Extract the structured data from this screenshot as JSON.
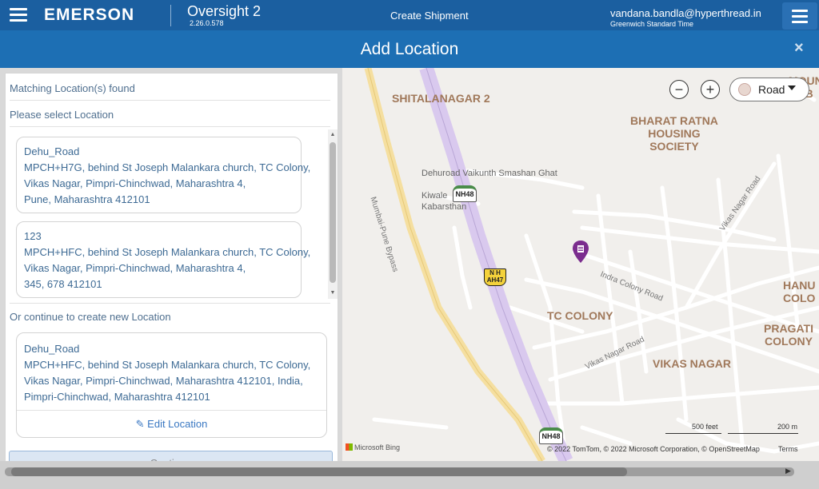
{
  "topbar": {
    "brand": "EMERSON",
    "app_name": "Oversight 2",
    "app_version": "2.26.0.578",
    "page_name": "Create Shipment",
    "user_email": "vandana.bandla@hyperthread.in",
    "user_timezone": "Greenwich Standard Time"
  },
  "dialog": {
    "title": "Add Location",
    "close_glyph": "×"
  },
  "left_panel": {
    "matching_heading": "Matching Location(s) found",
    "select_heading": "Please select Location",
    "locations": [
      {
        "lines": [
          "Dehu_Road",
          "MPCH+H7G, behind St Joseph Malankara church, TC Colony,",
          "Vikas Nagar, Pimpri-Chinchwad, Maharashtra 4,",
          "Pune, Maharashtra 412101"
        ]
      },
      {
        "lines": [
          "123",
          "MPCH+HFC, behind St Joseph Malankara church, TC Colony,",
          "Vikas Nagar, Pimpri-Chinchwad, Maharashtra 4,",
          "345, 678 412101"
        ]
      }
    ],
    "create_heading": "Or continue to create new Location",
    "new_location": {
      "lines": [
        "Dehu_Road",
        "MPCH+HFC, behind St Joseph Malankara church, TC Colony,",
        "Vikas Nagar, Pimpri-Chinchwad, Maharashtra 412101, India,",
        "Pimpri-Chinchwad, Maharashtra 412101"
      ],
      "edit_label": "Edit Location"
    },
    "continue_label": "Continue"
  },
  "map": {
    "zoom_out": "−",
    "zoom_in": "+",
    "map_type": "Road",
    "areas": {
      "shitalanagar": "SHITALANAGAR 2",
      "bharat_ratna": [
        "BHARAT RATNA",
        "HOUSING",
        "SOCIETY"
      ],
      "mount": "MOUNT B",
      "tc_colony": "TC COLONY",
      "vikas_nagar": "VIKAS NAGAR",
      "pragati": [
        "PRAGATI",
        "COLONY"
      ],
      "hanuman": [
        "HANU",
        "COLO"
      ]
    },
    "pois": {
      "smashan": "Dehuroad Vaikunth Smashan Ghat",
      "kiwale": [
        "Kiwale",
        "Kabarsthan"
      ]
    },
    "streets": {
      "bypass": "Mumbai-Pune Bypass",
      "indra": "Indra Colony Road",
      "vikas_road": "Vikas Nagar Road",
      "vikas_road_2": "Vikas Nagar Road"
    },
    "shields": {
      "nh48_top": "NH48",
      "nh48_bottom": "NH48",
      "ah47_line1": "N H",
      "ah47_line2": "AH47"
    },
    "scale_feet": "500 feet",
    "scale_m": "200 m",
    "provider": "Microsoft Bing",
    "copyright": "© 2022 TomTom, © 2022 Microsoft Corporation, © OpenStreetMap",
    "terms": "Terms",
    "colors": {
      "highway": "#d9c9ee",
      "bypass": "#f5dfa0",
      "pin": "#7b2d8e"
    }
  }
}
